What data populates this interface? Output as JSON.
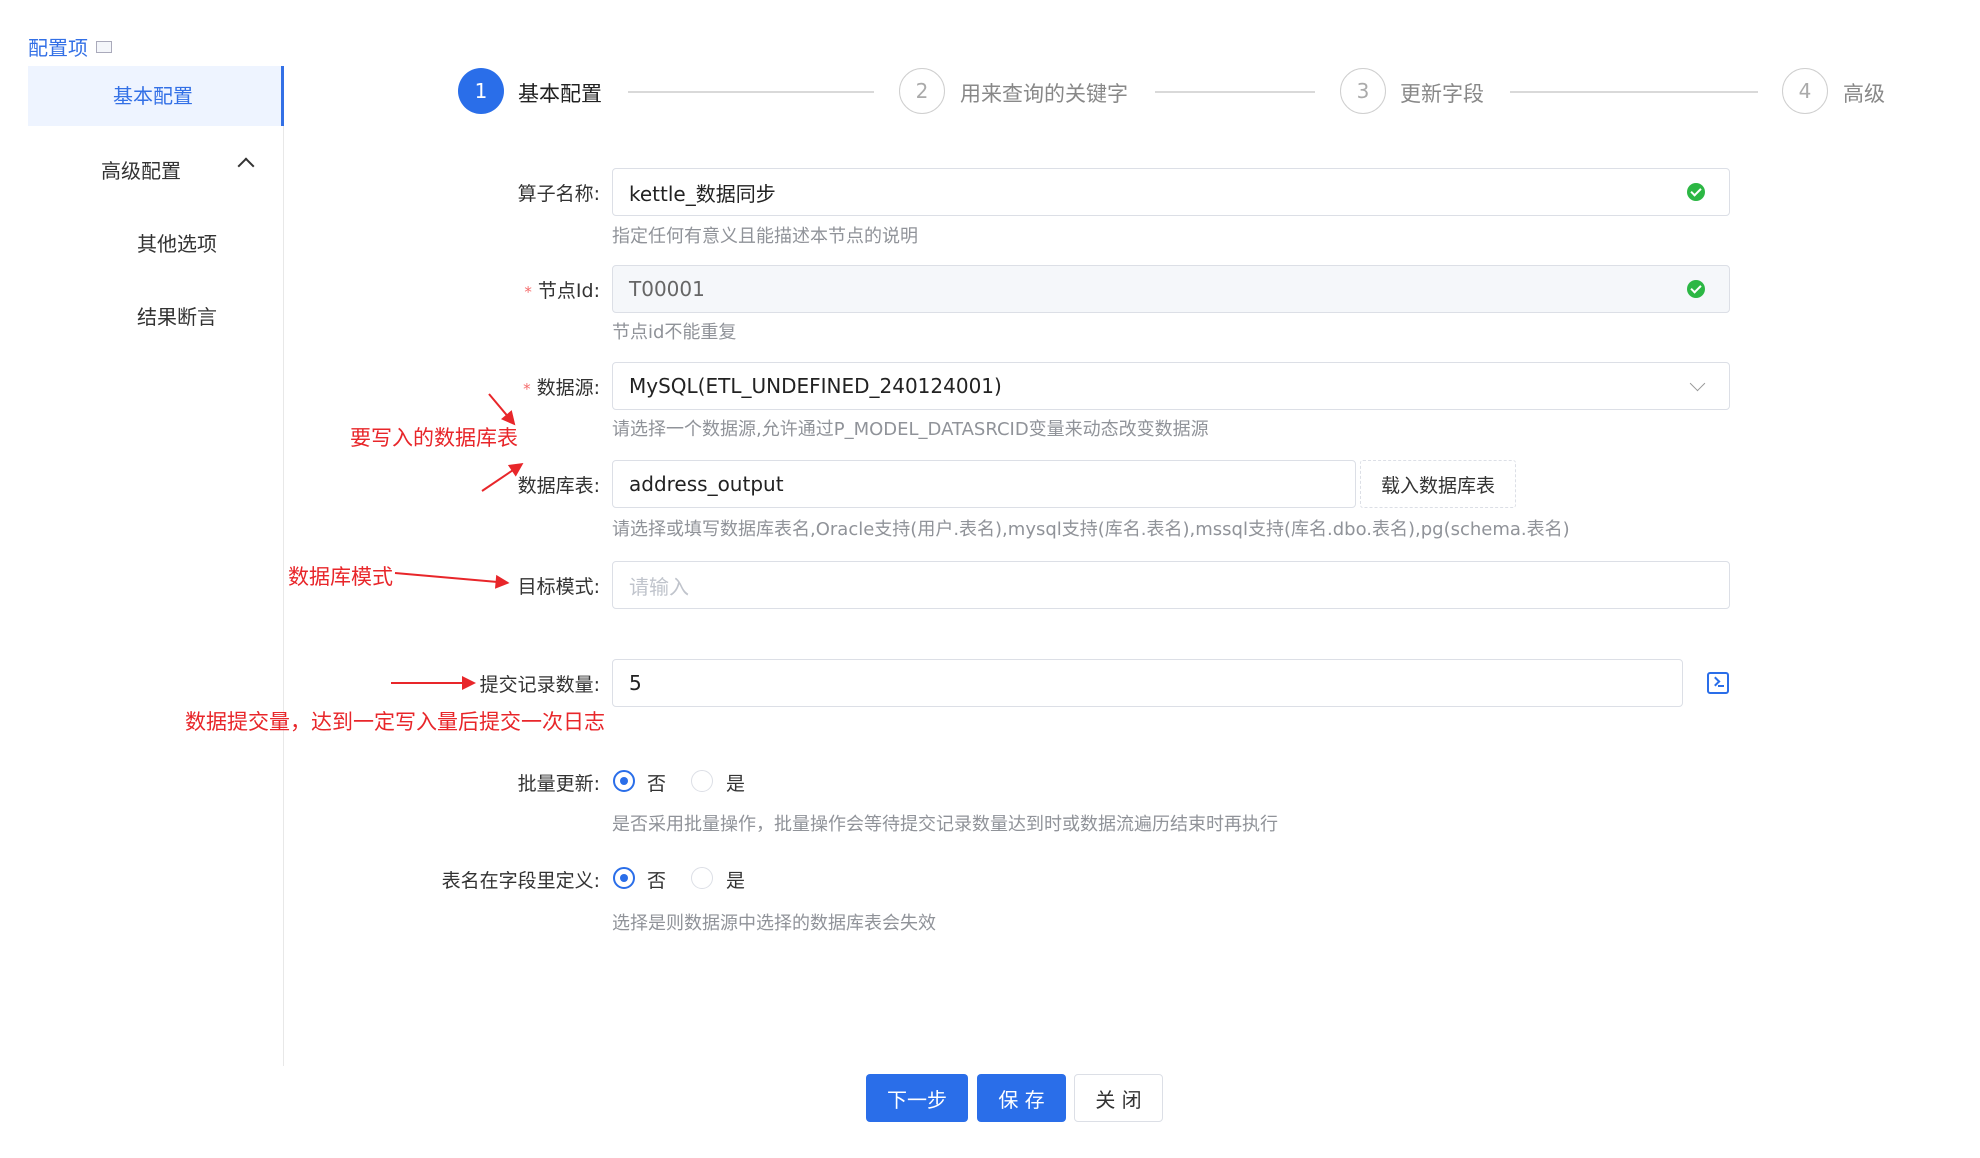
{
  "sidebar": {
    "title": "配置项",
    "items": [
      {
        "label": "基本配置"
      },
      {
        "label": "高级配置"
      },
      {
        "label": "其他选项"
      },
      {
        "label": "结果断言"
      }
    ]
  },
  "steps": [
    {
      "num": "1",
      "label": "基本配置"
    },
    {
      "num": "2",
      "label": "用来查询的关键字"
    },
    {
      "num": "3",
      "label": "更新字段"
    },
    {
      "num": "4",
      "label": "高级"
    }
  ],
  "form": {
    "operator_name": {
      "label": "算子名称:",
      "value": "kettle_数据同步",
      "help": "指定任何有意义且能描述本节点的说明"
    },
    "node_id": {
      "label": "节点Id:",
      "required": "*",
      "value": "T00001",
      "help": "节点id不能重复"
    },
    "datasource": {
      "label": "数据源:",
      "required": "*",
      "value": "MySQL(ETL_UNDEFINED_240124001)",
      "help": "请选择一个数据源,允许通过P_MODEL_DATASRCID变量来动态改变数据源"
    },
    "db_table": {
      "label": "数据库表:",
      "value": "address_output",
      "button": "载入数据库表",
      "help": "请选择或填写数据库表名,Oracle支持(用户.表名),mysql支持(库名.表名),mssql支持(库名.dbo.表名),pg(schema.表名)"
    },
    "target_schema": {
      "label": "目标模式:",
      "placeholder": "请输入"
    },
    "commit_size": {
      "label": "提交记录数量:",
      "value": "5"
    },
    "batch_update": {
      "label": "批量更新:",
      "options": [
        "否",
        "是"
      ],
      "selected": "否",
      "help": "是否采用批量操作，批量操作会等待提交记录数量达到时或数据流遍历结束时再执行"
    },
    "table_in_field": {
      "label": "表名在字段里定义:",
      "options": [
        "否",
        "是"
      ],
      "selected": "否",
      "help": "选择是则数据源中选择的数据库表会失效"
    }
  },
  "annotations": {
    "db_table_note": "要写入的数据库表",
    "schema_note": "数据库模式",
    "commit_note": "数据提交量，达到一定写入量后提交一次日志"
  },
  "buttons": {
    "next": "下一步",
    "save": "保 存",
    "close": "关 闭"
  },
  "colors": {
    "primary": "#2a6ee9",
    "annotation": "#e8262a",
    "success": "#2cb744"
  }
}
